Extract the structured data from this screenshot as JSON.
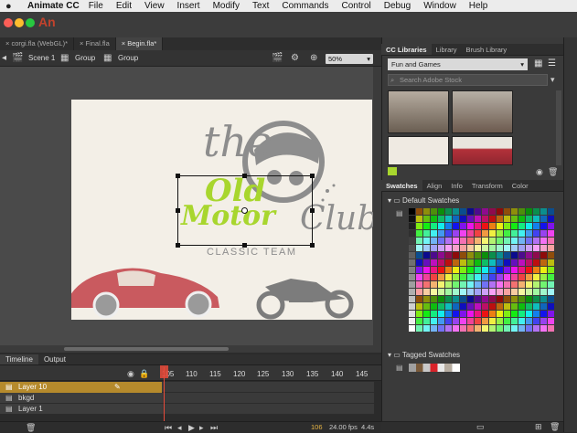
{
  "menubar": {
    "app_name": "Animate CC",
    "items": [
      "File",
      "Edit",
      "View",
      "Insert",
      "Modify",
      "Text",
      "Commands",
      "Control",
      "Debug",
      "Window",
      "Help"
    ]
  },
  "titlebar": {
    "logo": "An"
  },
  "doc_tabs": [
    "corgi.fla (WebGL)*",
    "Final.fla",
    "Begin.fla*"
  ],
  "editbar": {
    "scene": "Scene 1",
    "crumb1": "Group",
    "crumb2": "Group",
    "zoom": "50%"
  },
  "stage": {
    "title_word": "the",
    "word_old": "Old",
    "word_motor": "Motor",
    "word_club": "Club",
    "subtitle": "CLASSIC TEAM"
  },
  "timeline": {
    "tabs": [
      "Timeline",
      "Output"
    ],
    "frame_numbers": [
      "105",
      "110",
      "115",
      "120",
      "125",
      "130",
      "135",
      "140",
      "145"
    ],
    "layers": [
      "Layer 10",
      "bkgd",
      "Layer 1"
    ],
    "footer_frame": "106",
    "footer_fps": "24.00 fps",
    "footer_time": "4.4s"
  },
  "libraries": {
    "tabs": [
      "CC Libraries",
      "Library",
      "Brush Library"
    ],
    "selected_library": "Fun and Games",
    "search_placeholder": "Search Adobe Stock"
  },
  "swatches": {
    "tabs": [
      "Swatches",
      "Align",
      "Info",
      "Transform",
      "Color"
    ],
    "default_group": "Default Swatches",
    "tagged_group": "Tagged Swatches"
  },
  "colors": {
    "accent_red": "#e64a3a",
    "selected_layer": "#b58a2c",
    "logo_gray": "#8d8d8d",
    "logo_green": "#a8d62e",
    "car_red": "#c95a5f"
  }
}
